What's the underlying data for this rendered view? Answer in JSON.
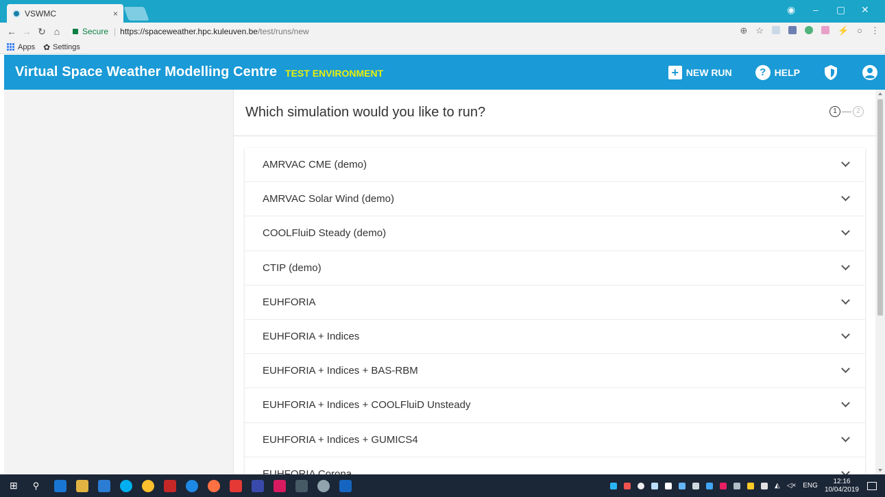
{
  "browser": {
    "tab_title": "VSWMC",
    "tab_close": "×",
    "secure_label": "Secure",
    "url_host": "https://spaceweather.hpc.kuleuven.be",
    "url_path": "/test/runs/new",
    "bookmarks": [
      {
        "label": "Apps"
      },
      {
        "label": "Settings"
      }
    ]
  },
  "app": {
    "title": "Virtual Space Weather Modelling Centre",
    "environment": "TEST ENVIRONMENT",
    "new_run_label": "NEW RUN",
    "help_label": "HELP",
    "accent_color": "#1a9ad6",
    "environment_color": "#e8f00a"
  },
  "main": {
    "question": "Which simulation would you like to run?",
    "steps": [
      "1",
      "2"
    ],
    "current_step": 1,
    "simulations": [
      "AMRVAC CME (demo)",
      "AMRVAC Solar Wind (demo)",
      "COOLFluiD Steady (demo)",
      "CTIP (demo)",
      "EUHFORIA",
      "EUHFORIA + Indices",
      "EUHFORIA + Indices + BAS-RBM",
      "EUHFORIA + Indices + COOLFluiD Unsteady",
      "EUHFORIA + Indices + GUMICS4",
      "EUHFORIA Corona"
    ]
  },
  "taskbar": {
    "language": "ENG",
    "time": "12:16",
    "date": "10/04/2019"
  }
}
